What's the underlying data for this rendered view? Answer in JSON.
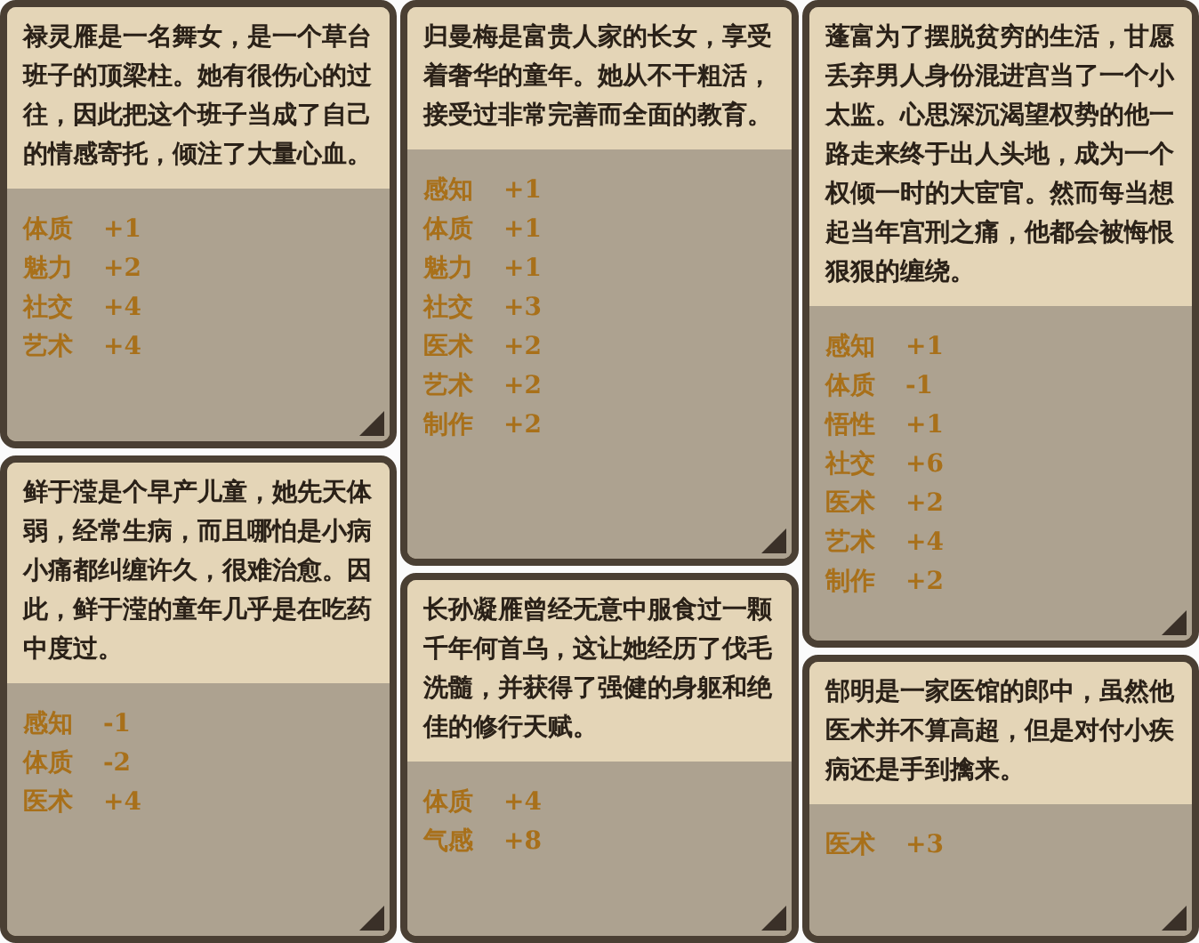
{
  "columns": [
    {
      "cards": [
        {
          "description": "禄灵雁是一名舞女，是一个草台班子的顶梁柱。她有很伤心的过往，因此把这个班子当成了自己的情感寄托，倾注了大量心血。",
          "stats": [
            {
              "name": "体质",
              "value": "+1"
            },
            {
              "name": "魅力",
              "value": "+2"
            },
            {
              "name": "社交",
              "value": "+4"
            },
            {
              "name": "艺术",
              "value": "+4"
            }
          ]
        },
        {
          "description": "鲜于滢是个早产儿童，她先天体弱，经常生病，而且哪怕是小病小痛都纠缠许久，很难治愈。因此，鲜于滢的童年几乎是在吃药中度过。",
          "stats": [
            {
              "name": "感知",
              "value": "-1"
            },
            {
              "name": "体质",
              "value": "-2"
            },
            {
              "name": "医术",
              "value": "+4"
            }
          ]
        }
      ]
    },
    {
      "cards": [
        {
          "description": "归曼梅是富贵人家的长女，享受着奢华的童年。她从不干粗活，接受过非常完善而全面的教育。",
          "stats": [
            {
              "name": "感知",
              "value": "+1"
            },
            {
              "name": "体质",
              "value": "+1"
            },
            {
              "name": "魅力",
              "value": "+1"
            },
            {
              "name": "社交",
              "value": "+3"
            },
            {
              "name": "医术",
              "value": "+2"
            },
            {
              "name": "艺术",
              "value": "+2"
            },
            {
              "name": "制作",
              "value": "+2"
            }
          ]
        },
        {
          "description": "长孙凝雁曾经无意中服食过一颗千年何首乌，这让她经历了伐毛洗髓，并获得了强健的身躯和绝佳的修行天赋。",
          "stats": [
            {
              "name": "体质",
              "value": "+4"
            },
            {
              "name": "气感",
              "value": "+8"
            }
          ]
        }
      ]
    },
    {
      "cards": [
        {
          "description": "蓬富为了摆脱贫穷的生活，甘愿丢弃男人身份混进宫当了一个小太监。心思深沉渴望权势的他一路走来终于出人头地，成为一个权倾一时的大宦官。然而每当想起当年宫刑之痛，他都会被悔恨狠狠的缠绕。",
          "stats": [
            {
              "name": "感知",
              "value": "+1"
            },
            {
              "name": "体质",
              "value": "-1"
            },
            {
              "name": "悟性",
              "value": "+1"
            },
            {
              "name": "社交",
              "value": "+6"
            },
            {
              "name": "医术",
              "value": "+2"
            },
            {
              "name": "艺术",
              "value": "+4"
            },
            {
              "name": "制作",
              "value": "+2"
            }
          ]
        },
        {
          "description": "郜明是一家医馆的郎中，虽然他医术并不算高超，但是对付小疾病还是手到擒来。",
          "stats": [
            {
              "name": "医术",
              "value": "+3"
            }
          ]
        }
      ]
    }
  ]
}
